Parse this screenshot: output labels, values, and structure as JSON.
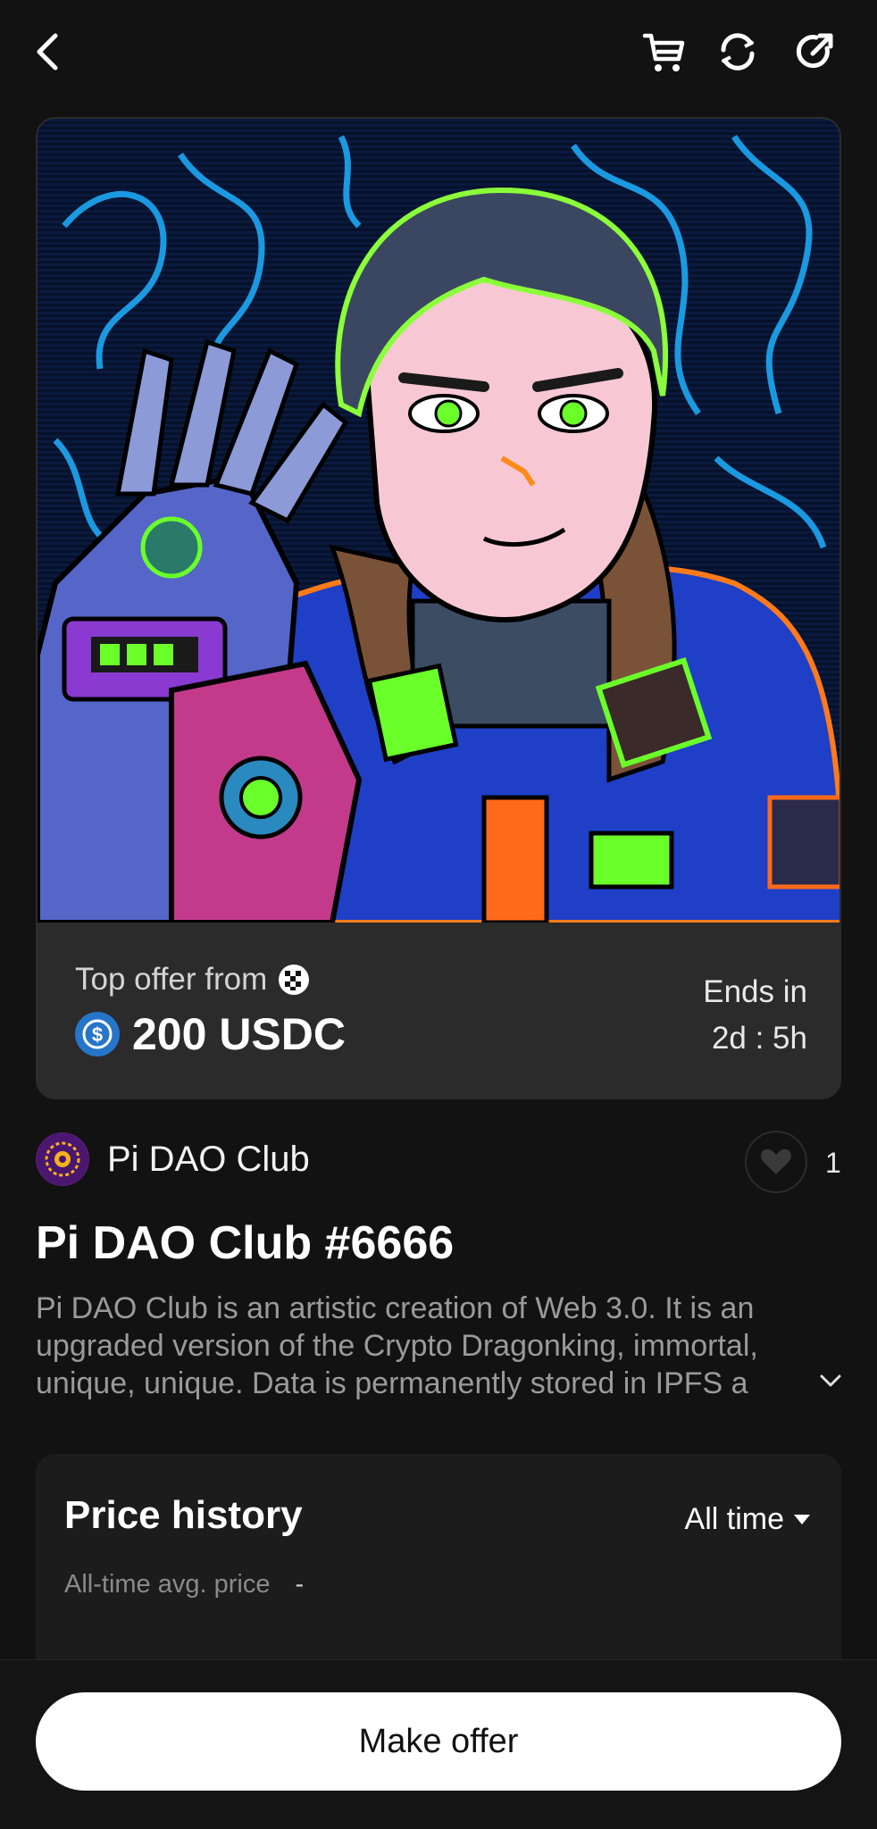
{
  "offer": {
    "label": "Top offer from",
    "amount": "200 USDC",
    "currency_symbol": "$",
    "ends_label": "Ends in",
    "ends_value": "2d : 5h"
  },
  "collection": {
    "name": "Pi DAO Club",
    "like_count": "1"
  },
  "nft": {
    "title": "Pi DAO Club #6666",
    "description": "Pi DAO Club is an artistic creation of Web 3.0. It is an upgraded version of the Crypto Dragonking, immortal, unique, unique. Data is permanently stored in IPFS a"
  },
  "price_history": {
    "title": "Price history",
    "range": "All time",
    "avg_label": "All-time avg. price",
    "avg_value": "-"
  },
  "actions": {
    "make_offer": "Make offer"
  },
  "colors": {
    "background": "#121212",
    "usdc": "#2775ca",
    "neon_blue": "#1fb1ff",
    "neon_green": "#8bff3a"
  }
}
